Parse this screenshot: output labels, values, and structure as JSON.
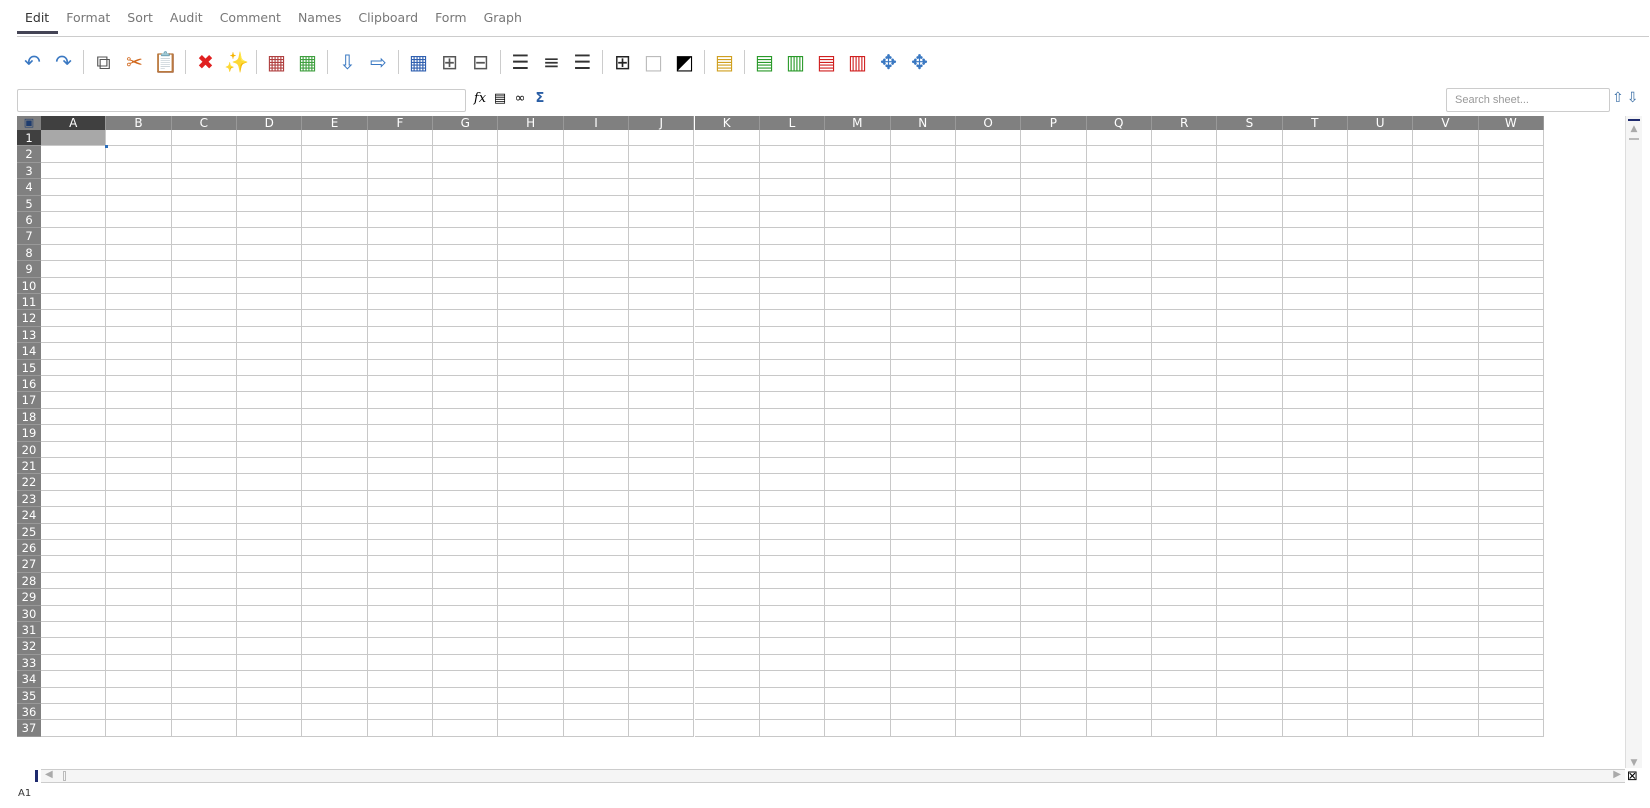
{
  "tabs": [
    "Edit",
    "Format",
    "Sort",
    "Audit",
    "Comment",
    "Names",
    "Clipboard",
    "Form",
    "Graph"
  ],
  "active_tab": "Edit",
  "toolbar": [
    {
      "name": "undo-icon",
      "glyph": "↶",
      "color": "#3a78c2"
    },
    {
      "name": "redo-icon",
      "glyph": "↷",
      "color": "#3a78c2"
    },
    {
      "sep": true
    },
    {
      "name": "copy-icon",
      "glyph": "⧉",
      "color": "#555"
    },
    {
      "name": "cut-icon",
      "glyph": "✂",
      "color": "#d2691e"
    },
    {
      "name": "paste-icon",
      "glyph": "📋",
      "color": "#c8961e"
    },
    {
      "sep": true
    },
    {
      "name": "delete-icon",
      "glyph": "✖",
      "color": "#e02020"
    },
    {
      "name": "magic-wand-icon",
      "glyph": "✨",
      "color": "#c8a800"
    },
    {
      "sep": true
    },
    {
      "name": "lock-cell-icon",
      "glyph": "▦",
      "color": "#b04040"
    },
    {
      "name": "edit-cell-icon",
      "glyph": "▦",
      "color": "#40a040"
    },
    {
      "sep": true
    },
    {
      "name": "fill-down-icon",
      "glyph": "⇩",
      "color": "#3a78c2"
    },
    {
      "name": "fill-right-icon",
      "glyph": "⇨",
      "color": "#3a78c2"
    },
    {
      "sep": true
    },
    {
      "name": "format-cells-icon",
      "glyph": "▦",
      "color": "#3060b0"
    },
    {
      "name": "merge-cells-icon",
      "glyph": "⊞",
      "color": "#555"
    },
    {
      "name": "unmerge-cells-icon",
      "glyph": "⊟",
      "color": "#555"
    },
    {
      "sep": true
    },
    {
      "name": "align-left-icon",
      "glyph": "☰",
      "color": "#333"
    },
    {
      "name": "align-center-icon",
      "glyph": "≡",
      "color": "#333"
    },
    {
      "name": "align-right-icon",
      "glyph": "☰",
      "color": "#333"
    },
    {
      "sep": true
    },
    {
      "name": "borders-icon",
      "glyph": "⊞",
      "color": "#222"
    },
    {
      "name": "no-borders-icon",
      "glyph": "□",
      "color": "#bbb"
    },
    {
      "name": "swap-colors-icon",
      "glyph": "◩",
      "color": "#000"
    },
    {
      "sep": true
    },
    {
      "name": "insert-row-line-icon",
      "glyph": "▤",
      "color": "#d0a020"
    },
    {
      "sep": true
    },
    {
      "name": "insert-row-icon",
      "glyph": "▤",
      "color": "#2a9a2a"
    },
    {
      "name": "insert-column-icon",
      "glyph": "▥",
      "color": "#2a9a2a"
    },
    {
      "name": "delete-row-icon",
      "glyph": "▤",
      "color": "#d02020"
    },
    {
      "name": "delete-column-icon",
      "glyph": "▥",
      "color": "#d02020"
    },
    {
      "name": "split-pane-icon",
      "glyph": "✥",
      "color": "#3a78c2"
    },
    {
      "name": "unsplit-pane-icon",
      "glyph": "✥",
      "color": "#3a78c2"
    }
  ],
  "formula_bar": {
    "value": "",
    "icons": [
      "fx",
      "▤",
      "∞",
      "Σ"
    ]
  },
  "search": {
    "placeholder": "Search sheet..."
  },
  "columns": [
    "A",
    "B",
    "C",
    "D",
    "E",
    "F",
    "G",
    "H",
    "I",
    "J",
    "K",
    "L",
    "M",
    "N",
    "O",
    "P",
    "Q",
    "R",
    "S",
    "T",
    "U",
    "V",
    "W"
  ],
  "rows": [
    "1",
    "2",
    "3",
    "4",
    "5",
    "6",
    "7",
    "8",
    "9",
    "10",
    "11",
    "12",
    "13",
    "14",
    "15",
    "16",
    "17",
    "18",
    "19",
    "20",
    "21",
    "22",
    "23",
    "24",
    "25",
    "26",
    "27",
    "28",
    "29",
    "30",
    "31",
    "32",
    "33",
    "34",
    "35",
    "36",
    "37"
  ],
  "selected_cell": "A1",
  "status": "A1"
}
